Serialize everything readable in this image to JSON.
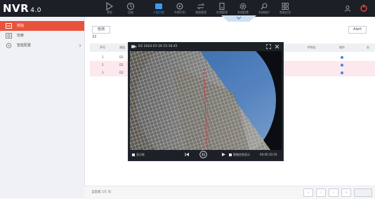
{
  "app": {
    "name": "NVR",
    "version": "4.0"
  },
  "topnav": [
    {
      "label": "预览",
      "icon": "preview-icon"
    },
    {
      "label": "回放",
      "icon": "playback-icon"
    },
    {
      "label": "人脸识别",
      "icon": "face-icon",
      "active": true
    },
    {
      "label": "车牌识别",
      "icon": "plate-icon"
    },
    {
      "label": "通道管理",
      "icon": "channel-icon"
    },
    {
      "label": "存储管理",
      "icon": "storage-icon"
    },
    {
      "label": "系统配置",
      "icon": "settings-icon"
    },
    {
      "label": "系统维护",
      "icon": "maintenance-icon"
    },
    {
      "label": "智能应用",
      "icon": "apps-icon"
    }
  ],
  "sidebar": {
    "items": [
      {
        "label": "抓拍",
        "icon": "capture-icon",
        "active": true
      },
      {
        "label": "检索",
        "icon": "search-icon"
      },
      {
        "label": "智能配置",
        "icon": "smart-config-icon"
      }
    ]
  },
  "toolbar": {
    "left_button": "检测",
    "right_button": "Alert",
    "count": "33"
  },
  "table": {
    "headers": [
      "序号",
      "通道",
      "时间",
      "",
      "",
      "",
      "IP地址",
      "",
      "操作",
      "名"
    ],
    "rows": [
      {
        "index": "1",
        "channel": "D2"
      },
      {
        "index": "2",
        "channel": "D2",
        "selected": true
      },
      {
        "index": "3",
        "channel": "D2",
        "selected": true
      }
    ]
  },
  "footer": {
    "text": "当前第 1/1 页"
  },
  "player": {
    "title": "D2 2024-07-29 15:16:45",
    "controls": {
      "left_label": "显示框",
      "right_label": "智能信息显示",
      "timestamp": "00:00:10:16"
    }
  },
  "colors": {
    "accent": "#e8533c",
    "topbar": "#1c1f26",
    "active_nav": "#3a9bf0"
  }
}
